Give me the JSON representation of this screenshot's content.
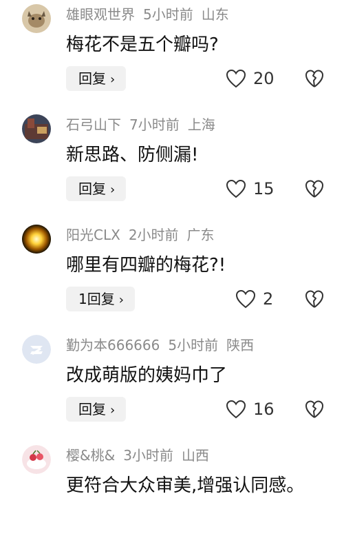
{
  "labels": {
    "reply": "回复",
    "chevron": "›"
  },
  "comments": [
    {
      "user": "雄眼观世界",
      "time": "5小时前",
      "location": "山东",
      "text": "梅花不是五个瓣吗?",
      "reply_count": "",
      "likes": "20",
      "avatar_colors": [
        "#d8c7a8",
        "#6b5a44"
      ]
    },
    {
      "user": "石弓山下",
      "time": "7小时前",
      "location": "上海",
      "text": "新思路、防侧漏!",
      "reply_count": "",
      "likes": "15",
      "avatar_colors": [
        "#3c4458",
        "#8a4a3a"
      ]
    },
    {
      "user": "阳光CLX",
      "time": "2小时前",
      "location": "广东",
      "text": "哪里有四瓣的梅花?!",
      "reply_count": "1",
      "likes": "2",
      "avatar_colors": [
        "#fff3a0",
        "#1a1200"
      ]
    },
    {
      "user": "勤为本666666",
      "time": "5小时前",
      "location": "陕西",
      "text": "改成萌版的姨妈巾了",
      "reply_count": "",
      "likes": "16",
      "avatar_colors": [
        "#dfe6f2",
        "#ffffff"
      ]
    },
    {
      "user": "樱&桃&",
      "time": "3小时前",
      "location": "山西",
      "text": "更符合大众审美,增强认同感。",
      "reply_count": "",
      "likes": "",
      "avatar_colors": [
        "#f7e3e6",
        "#d33a4a"
      ]
    }
  ]
}
